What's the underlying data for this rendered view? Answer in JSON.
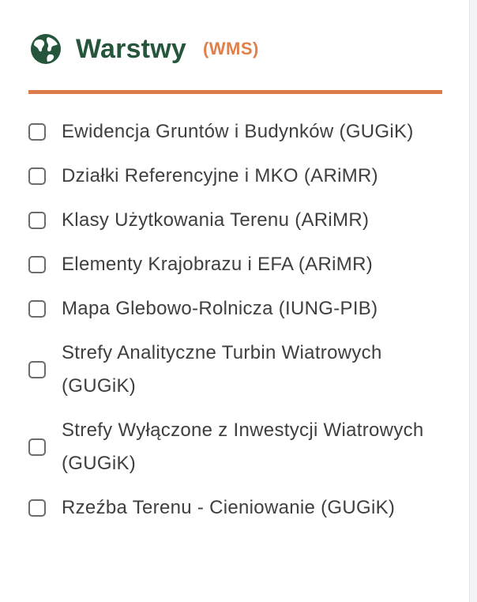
{
  "panel": {
    "icon": "globe-icon",
    "title": "Warstwy",
    "subtitle": "(WMS)",
    "colors": {
      "title": "#25563b",
      "accent": "#e07f4a"
    }
  },
  "layers": [
    {
      "label": "Ewidencja Gruntów i Budynków (GUGiK)",
      "checked": false
    },
    {
      "label": "Działki Referencyjne i MKO (ARiMR)",
      "checked": false
    },
    {
      "label": "Klasy Użytkowania Terenu (ARiMR)",
      "checked": false
    },
    {
      "label": "Elementy Krajobrazu i EFA (ARiMR)",
      "checked": false
    },
    {
      "label": "Mapa Glebowo-Rolnicza (IUNG-PIB)",
      "checked": false
    },
    {
      "label": "Strefy Analityczne Turbin Wiatrowych (GUGiK)",
      "checked": false
    },
    {
      "label": "Strefy Wyłączone z Inwestycji Wiatrowych (GUGiK)",
      "checked": false
    },
    {
      "label": "Rzeźba Terenu - Cieniowanie (GUGiK)",
      "checked": false
    }
  ]
}
